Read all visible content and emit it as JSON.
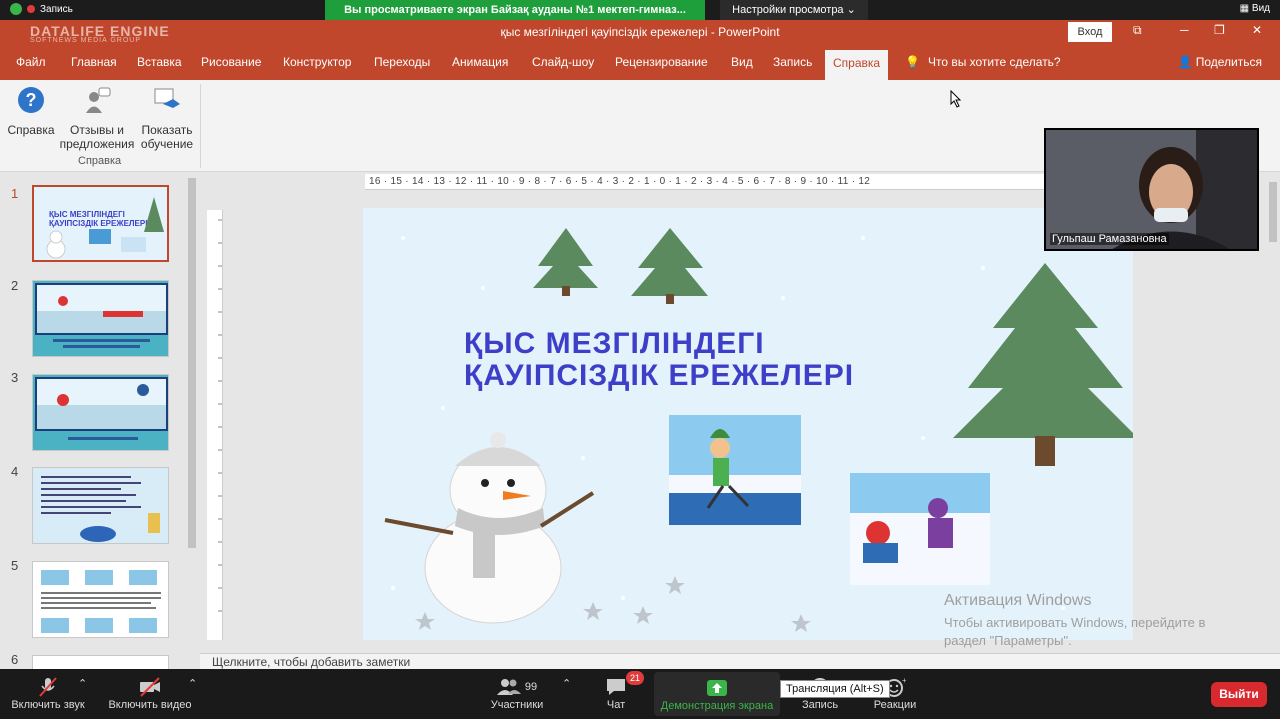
{
  "zoom_top": {
    "recording_label": "Запись",
    "share_banner": "Вы просматриваете экран Байзақ ауданы №1 мектеп-гимназ...",
    "view_settings": "Настройки просмотра",
    "view_label": "Вид"
  },
  "window": {
    "watermark": "DATALIFE ENGINE",
    "watermark_sub": "SOFTNEWS MEDIA GROUP",
    "title": "қыс мезгіліндегі қауіпсіздік ережелері  -  PowerPoint",
    "login_button": "Вход"
  },
  "ribbon": {
    "tabs": [
      "Файл",
      "Главная",
      "Вставка",
      "Рисование",
      "Конструктор",
      "Переходы",
      "Анимация",
      "Слайд-шоу",
      "Рецензирование",
      "Вид",
      "Запись",
      "Справка"
    ],
    "active_tab": "Справка",
    "tell_me": "Что вы хотите сделать?",
    "share": "Поделиться",
    "buttons": {
      "help": "Справка",
      "feedback_line1": "Отзывы и",
      "feedback_line2": "предложения",
      "training_line1": "Показать",
      "training_line2": "обучение"
    },
    "group_label": "Справка"
  },
  "thumbnails": {
    "numbers": [
      "1",
      "2",
      "3",
      "4",
      "5",
      "6"
    ],
    "selected": "1"
  },
  "ruler": {
    "horizontal": "16 · 15 · 14 · 13 · 12 · 11 · 10 · 9 · 8 · 7 · 6 · 5 · 4 · 3 · 2 · 1 · 0 · 1 · 2 · 3 · 4 · 5 · 6 · 7 · 8 · 9 · 10 · 11 · 12"
  },
  "slide": {
    "title_line1": "ҚЫС МЕЗГІЛІНДЕГІ",
    "title_line2": "ҚАУІПСІЗДІК ЕРЕЖЕЛЕРІ"
  },
  "activation": {
    "line1": "Активация Windows",
    "line2": "Чтобы активировать Windows, перейдите в",
    "line3": "раздел \"Параметры\"."
  },
  "notes_placeholder": "Щелкните, чтобы добавить заметки",
  "webcam": {
    "name": "Гульпаш Рамазановна"
  },
  "zoom_bottom": {
    "mute": "Включить звук",
    "video": "Включить видео",
    "participants": "Участники",
    "participants_count": "99",
    "chat": "Чат",
    "chat_count": "21",
    "share_screen": "Демонстрация экрана",
    "record": "Запись",
    "reactions": "Реакции",
    "tooltip": "Трансляция (Alt+S)",
    "leave": "Выйти"
  },
  "colors": {
    "ppt_accent": "#c0472b",
    "slide_title": "#3d3fc8",
    "zoom_green": "#1f9e3c",
    "leave_red": "#d8292f"
  }
}
